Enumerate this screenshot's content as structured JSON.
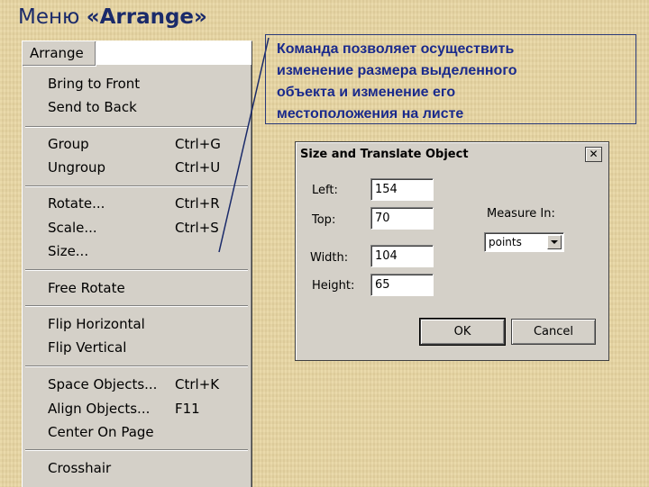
{
  "slide": {
    "title_prefix": "Меню ",
    "title_bold": "«Arrange»"
  },
  "callout": {
    "text": "Команда позволяет осуществить\nизменение размера выделенного\nобъекта и изменение его\nместоположения на листе"
  },
  "menu": {
    "header": "Arrange",
    "items": [
      {
        "label": "Bring to Front",
        "shortcut": ""
      },
      {
        "label": "Send to Back",
        "shortcut": ""
      },
      {
        "label": "Group",
        "shortcut": "Ctrl+G"
      },
      {
        "label": "Ungroup",
        "shortcut": "Ctrl+U"
      },
      {
        "label": "Rotate...",
        "shortcut": "Ctrl+R"
      },
      {
        "label": "Scale...",
        "shortcut": "Ctrl+S"
      },
      {
        "label": "Size...",
        "shortcut": ""
      },
      {
        "label": "Free Rotate",
        "shortcut": ""
      },
      {
        "label": "Flip Horizontal",
        "shortcut": ""
      },
      {
        "label": "Flip Vertical",
        "shortcut": ""
      },
      {
        "label": "Space Objects...",
        "shortcut": "Ctrl+K"
      },
      {
        "label": "Align Objects...",
        "shortcut": "F11"
      },
      {
        "label": "Center On Page",
        "shortcut": ""
      },
      {
        "label": "Crosshair",
        "shortcut": ""
      }
    ]
  },
  "dialog": {
    "title": "Size and Translate Object",
    "close_glyph": "✕",
    "left_label": "Left:",
    "left_value": "154",
    "top_label": "Top:",
    "top_value": "70",
    "width_label": "Width:",
    "width_value": "104",
    "height_label": "Height:",
    "height_value": "65",
    "measure_label": "Measure In:",
    "measure_value": "points",
    "ok_label": "OK",
    "cancel_label": "Cancel"
  }
}
